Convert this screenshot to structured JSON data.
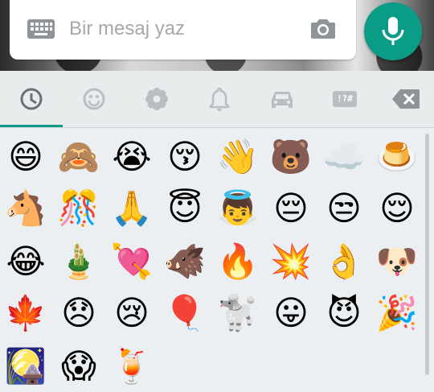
{
  "compose": {
    "placeholder": "Bir mesaj yaz",
    "keyboard_icon": "keyboard-icon",
    "camera_icon": "camera-icon",
    "mic_icon": "microphone-icon"
  },
  "colors": {
    "accent": "#0a9c86",
    "tab_icon": "#b9bec1",
    "tab_active": "#6b7174"
  },
  "tabs": [
    {
      "icon": "recent-clock-icon",
      "active": true
    },
    {
      "icon": "smiley-icon"
    },
    {
      "icon": "flower-gear-icon"
    },
    {
      "icon": "bell-icon"
    },
    {
      "icon": "car-icon"
    },
    {
      "icon": "symbols-icon",
      "label": "!?#"
    },
    {
      "icon": "backspace-icon"
    }
  ],
  "emojis": [
    [
      "😄",
      "🙈",
      "😭",
      "😚",
      "👋",
      "🐻",
      "☁️",
      "🍮"
    ],
    [
      "🐴",
      "🎊",
      "🙏",
      "😇",
      "👼",
      "😔",
      "😒",
      "😌"
    ],
    [
      "😂",
      "🎍",
      "💘",
      "🐗",
      "🔥",
      "💥",
      "👌",
      "🐶"
    ],
    [
      "🍁",
      "😞",
      "😢",
      "🎈",
      "🐩",
      "😛",
      "😈",
      "🎉"
    ],
    [
      "🎑",
      "😱",
      "🍹"
    ]
  ]
}
